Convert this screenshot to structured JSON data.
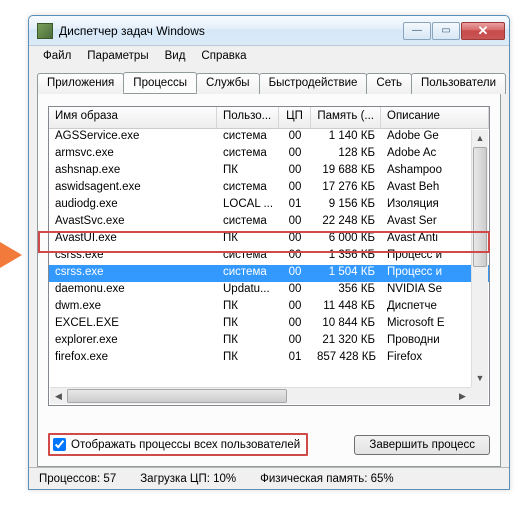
{
  "window": {
    "title": "Диспетчер задач Windows"
  },
  "menu": {
    "file": "Файл",
    "options": "Параметры",
    "view": "Вид",
    "help": "Справка"
  },
  "tabs": {
    "apps": "Приложения",
    "processes": "Процессы",
    "services": "Службы",
    "performance": "Быстродействие",
    "network": "Сеть",
    "users": "Пользователи"
  },
  "columns": {
    "image": "Имя образа",
    "user": "Пользо...",
    "cpu": "ЦП",
    "memory": "Память (...",
    "description": "Описание"
  },
  "rows": [
    {
      "img": "AGSService.exe",
      "user": "система",
      "cpu": "00",
      "mem": "1 140 КБ",
      "desc": "Adobe Ge"
    },
    {
      "img": "armsvc.exe",
      "user": "система",
      "cpu": "00",
      "mem": "128 КБ",
      "desc": "Adobe Ac"
    },
    {
      "img": "ashsnap.exe",
      "user": "ПК",
      "cpu": "00",
      "mem": "19 688 КБ",
      "desc": "Ashampoo"
    },
    {
      "img": "aswidsagent.exe",
      "user": "система",
      "cpu": "00",
      "mem": "17 276 КБ",
      "desc": "Avast Beh"
    },
    {
      "img": "audiodg.exe",
      "user": "LOCAL ...",
      "cpu": "01",
      "mem": "9 156 КБ",
      "desc": "Изоляция"
    },
    {
      "img": "AvastSvc.exe",
      "user": "система",
      "cpu": "00",
      "mem": "22 248 КБ",
      "desc": "Avast Ser"
    },
    {
      "img": "AvastUI.exe",
      "user": "ПК",
      "cpu": "00",
      "mem": "6 000 КБ",
      "desc": "Avast Anti"
    },
    {
      "img": "csrss.exe",
      "user": "система",
      "cpu": "00",
      "mem": "1 356 КБ",
      "desc": "Процесс и"
    },
    {
      "img": "csrss.exe",
      "user": "система",
      "cpu": "00",
      "mem": "1 504 КБ",
      "desc": "Процесс и",
      "selected": true
    },
    {
      "img": "daemonu.exe",
      "user": "Updatu...",
      "cpu": "00",
      "mem": "356 КБ",
      "desc": "NVIDIA Se"
    },
    {
      "img": "dwm.exe",
      "user": "ПК",
      "cpu": "00",
      "mem": "11 448 КБ",
      "desc": "Диспетче"
    },
    {
      "img": "EXCEL.EXE",
      "user": "ПК",
      "cpu": "00",
      "mem": "10 844 КБ",
      "desc": "Microsoft E"
    },
    {
      "img": "explorer.exe",
      "user": "ПК",
      "cpu": "00",
      "mem": "21 320 КБ",
      "desc": "Проводни"
    },
    {
      "img": "firefox.exe",
      "user": "ПК",
      "cpu": "01",
      "mem": "857 428 КБ",
      "desc": "Firefox"
    }
  ],
  "checkbox": {
    "label": "Отображать процессы всех пользователей",
    "checked": true
  },
  "buttons": {
    "end_process": "Завершить процесс"
  },
  "status": {
    "processes": "Процессов: 57",
    "cpu": "Загрузка ЦП: 10%",
    "memory": "Физическая память: 65%"
  }
}
